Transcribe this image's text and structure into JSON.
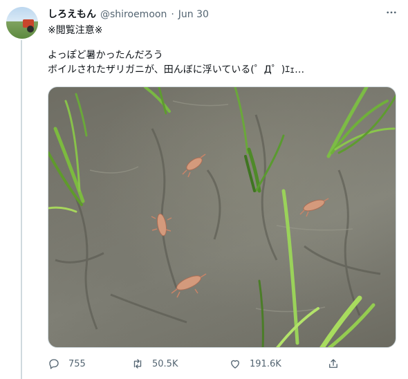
{
  "tweet": {
    "author": {
      "display_name": "しろえもん",
      "handle": "@shiroemoon",
      "separator": "·",
      "date": "Jun 30"
    },
    "text_lines": [
      "※閲覧注意※",
      "よっぽど暑かったんだろう",
      "ボイルされたザリガニが、田んぼに浮いている(゜Д゜)ｴｪ…"
    ],
    "more_icon": "more-horizontal-icon",
    "media_icon": "photo-rice-paddy-crayfish",
    "actions": {
      "reply": {
        "icon": "reply-icon",
        "count": "755"
      },
      "retweet": {
        "icon": "retweet-icon",
        "count": "50.5K"
      },
      "like": {
        "icon": "heart-icon",
        "count": "191.6K"
      },
      "share": {
        "icon": "share-icon"
      }
    }
  },
  "colors": {
    "text_primary": "#0f1419",
    "text_secondary": "#536471",
    "thread_line": "#cfd9de",
    "water": "#7b7a70",
    "crayfish": "#d49a7c",
    "rice_shoot": "#6fa83a"
  }
}
